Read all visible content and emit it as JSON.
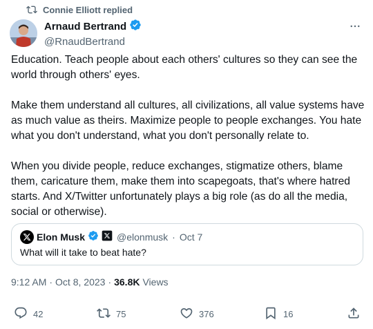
{
  "context": {
    "text": "Connie Elliott replied"
  },
  "author": {
    "name": "Arnaud Bertrand",
    "handle": "@RnaudBertrand"
  },
  "tweet": {
    "paragraphs": [
      "Education. Teach people about each others' cultures so they can see the world through others' eyes.",
      "Make them understand all cultures, all civilizations, all value systems have as much value as theirs. Maximize people to people exchanges. You hate what you don't understand, what you don't personally relate to.",
      "When you divide people, reduce exchanges, stigmatize others, blame them, caricature them, make them into scapegoats, that's where hatred starts. And X/Twitter unfortunately plays a big role (as do all the media, social or otherwise)."
    ]
  },
  "quote": {
    "name": "Elon Musk",
    "handle": "@elonmusk",
    "separator": "·",
    "date": "Oct 7",
    "text": "What will it take to beat hate?"
  },
  "meta": {
    "time": "9:12 AM",
    "dot1": "·",
    "date": "Oct 8, 2023",
    "dot2": "·",
    "views_count": "36.8K",
    "views_label": "Views"
  },
  "actions": {
    "replies": "42",
    "reposts": "75",
    "likes": "376",
    "bookmarks": "16"
  },
  "colors": {
    "verified": "#1d9bf0",
    "muted": "#536471",
    "text": "#0f1419",
    "border": "#cfd9de"
  },
  "icons": [
    "repost-icon",
    "verified-badge-icon",
    "more-icon",
    "x-logo-icon",
    "reply-icon",
    "like-icon",
    "bookmark-icon",
    "share-icon"
  ]
}
